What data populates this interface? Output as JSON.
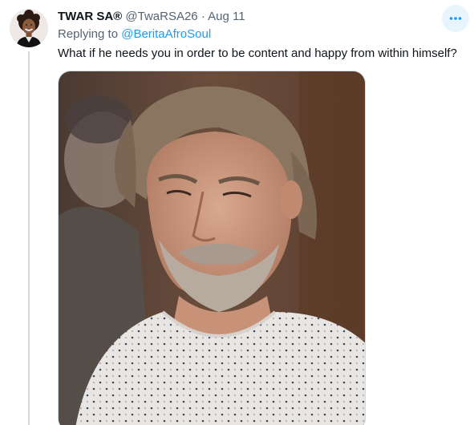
{
  "tweet": {
    "display_name": "TWAR SA®",
    "handle": "@TwaRSA26",
    "separator": "·",
    "date": "Aug 11",
    "replying_prefix": "Replying to ",
    "replying_to": "@BeritaAfroSoul",
    "text": "What if he needs you in order to be content and happy from within himself?",
    "more_icon": "more-horizontal-icon",
    "avatar_icon": "avatar",
    "media_icon": "photo"
  },
  "colors": {
    "accent": "#1d9bf0",
    "secondary_text": "#536471",
    "primary_text": "#0f1419",
    "more_button_bg": "#e8f5fd"
  }
}
